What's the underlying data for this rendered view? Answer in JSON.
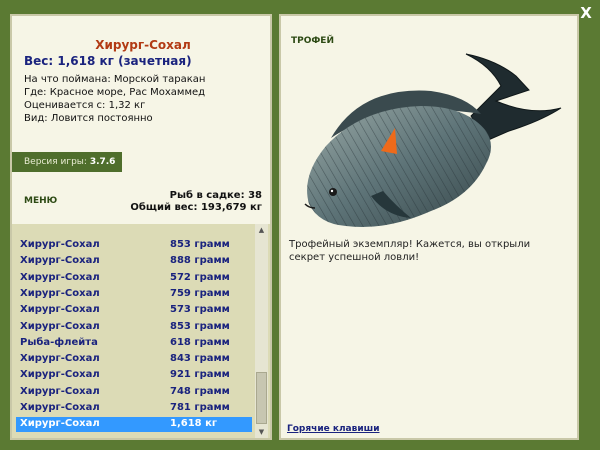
{
  "close_label": "X",
  "details": {
    "name": "Хирург-Сохал",
    "weight": "Вес: 1,618 кг (зачетная)",
    "bait": "На что поймана: Морской таракан",
    "place": "Где: Красное море, Рас Мохаммед",
    "value": "Оценивается с: 1,32 кг",
    "kind": "Вид: Ловится постоянно"
  },
  "version": {
    "label": "Версия игры:",
    "value": "3.7.6"
  },
  "menu_label": "МЕНЮ",
  "stats": {
    "fish_count": "Рыб в садке: 38",
    "total_weight": "Общий вес: 193,679 кг"
  },
  "catch_list": [
    {
      "name": "Хирург-Сохал",
      "weight": "853 грамм"
    },
    {
      "name": "Хирург-Сохал",
      "weight": "888 грамм"
    },
    {
      "name": "Хирург-Сохал",
      "weight": "572 грамм"
    },
    {
      "name": "Хирург-Сохал",
      "weight": "759 грамм"
    },
    {
      "name": "Хирург-Сохал",
      "weight": "573 грамм"
    },
    {
      "name": "Хирург-Сохал",
      "weight": "853 грамм"
    },
    {
      "name": "Рыба-флейта",
      "weight": "618 грамм"
    },
    {
      "name": "Хирург-Сохал",
      "weight": "843 грамм"
    },
    {
      "name": "Хирург-Сохал",
      "weight": "921 грамм"
    },
    {
      "name": "Хирург-Сохал",
      "weight": "748 грамм"
    },
    {
      "name": "Хирург-Сохал",
      "weight": "781 грамм"
    },
    {
      "name": "Хирург-Сохал",
      "weight": "1,618 кг"
    }
  ],
  "selected_index": 11,
  "trophy": {
    "title": "ТРОФЕЙ",
    "text": "Трофейный экземпляр! Кажется, вы открыли секрет успешной ловли!"
  },
  "hotkeys_label": "Горячие клавиши",
  "colors": {
    "background": "#5b7a33",
    "panel": "#f6f5e6",
    "list_background": "#dcdbb6",
    "selection": "#3399ff",
    "fish_name": "#b23a14",
    "list_text": "#1a237e"
  },
  "icons": {
    "close": "close-icon",
    "scroll_up": "arrow-up-icon",
    "scroll_down": "arrow-down-icon"
  }
}
